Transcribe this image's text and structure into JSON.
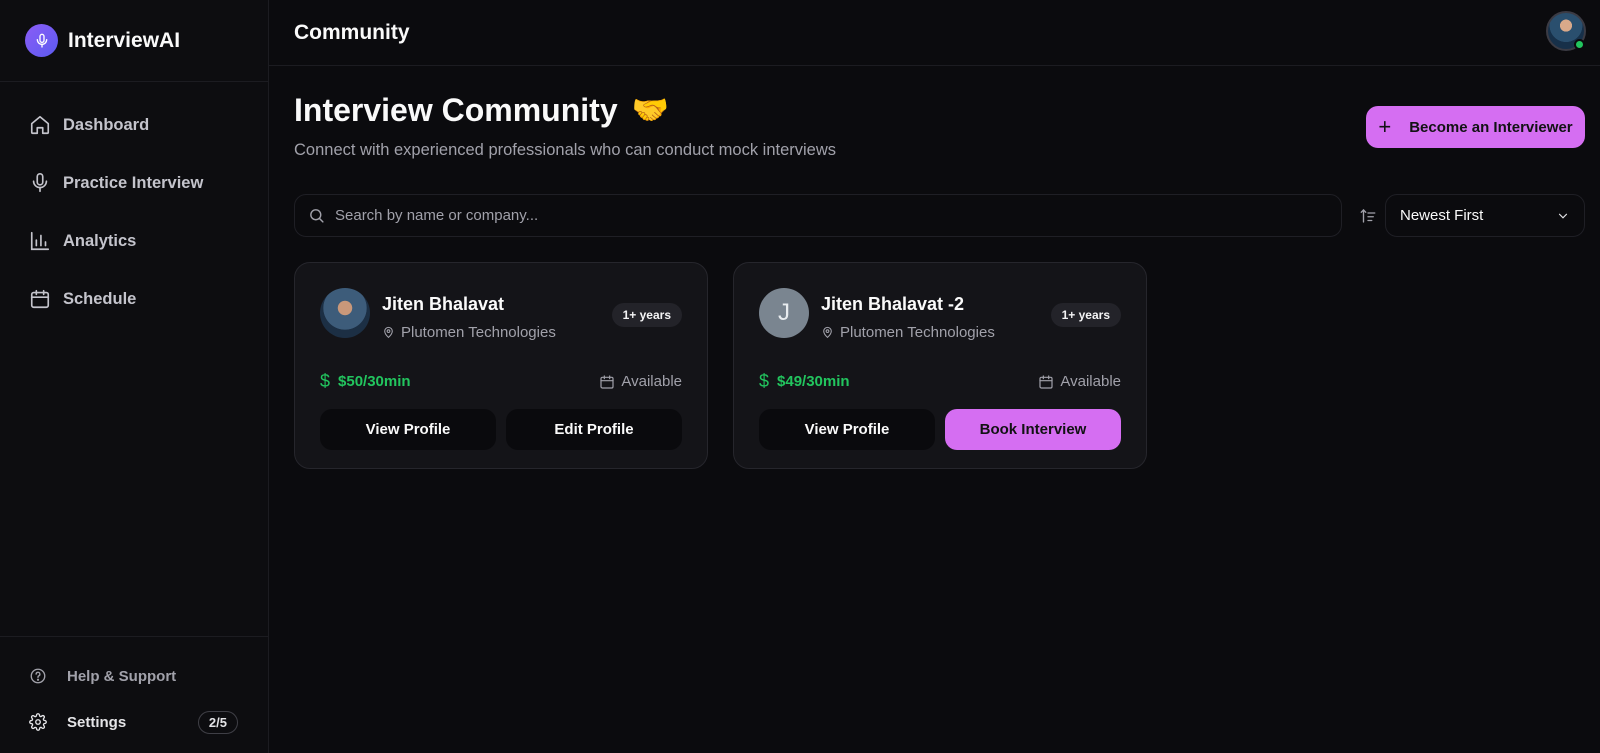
{
  "brand": {
    "name": "InterviewAI"
  },
  "sidebar": {
    "items": [
      {
        "label": "Dashboard",
        "icon": "home-icon"
      },
      {
        "label": "Practice Interview",
        "icon": "mic-icon"
      },
      {
        "label": "Analytics",
        "icon": "bar-chart-icon"
      },
      {
        "label": "Schedule",
        "icon": "calendar-icon"
      }
    ],
    "footer": {
      "help_label": "Help & Support",
      "settings_label": "Settings",
      "settings_badge": "2/5"
    }
  },
  "header": {
    "title": "Community"
  },
  "page": {
    "title": "Interview Community",
    "emoji": "🤝",
    "subtitle": "Connect with experienced professionals who can conduct mock interviews",
    "become_button": "Become an Interviewer"
  },
  "search": {
    "placeholder": "Search by name or company...",
    "value": ""
  },
  "sort": {
    "selected": "Newest First"
  },
  "cards": [
    {
      "name": "Jiten Bhalavat",
      "company": "Plutomen Technologies",
      "experience": "1+ years",
      "price": "$50/30min",
      "availability": "Available",
      "action_left": "View Profile",
      "action_right": "Edit Profile"
    },
    {
      "name": "Jiten Bhalavat -2",
      "avatar_letter": "J",
      "company": "Plutomen Technologies",
      "experience": "1+ years",
      "price": "$49/30min",
      "availability": "Available",
      "action_left": "View Profile",
      "action_right": "Book Interview"
    }
  ],
  "colors": {
    "accent": "#d56ef2",
    "price_green": "#22c55e",
    "background": "#0b0b0e",
    "card": "#141418"
  }
}
